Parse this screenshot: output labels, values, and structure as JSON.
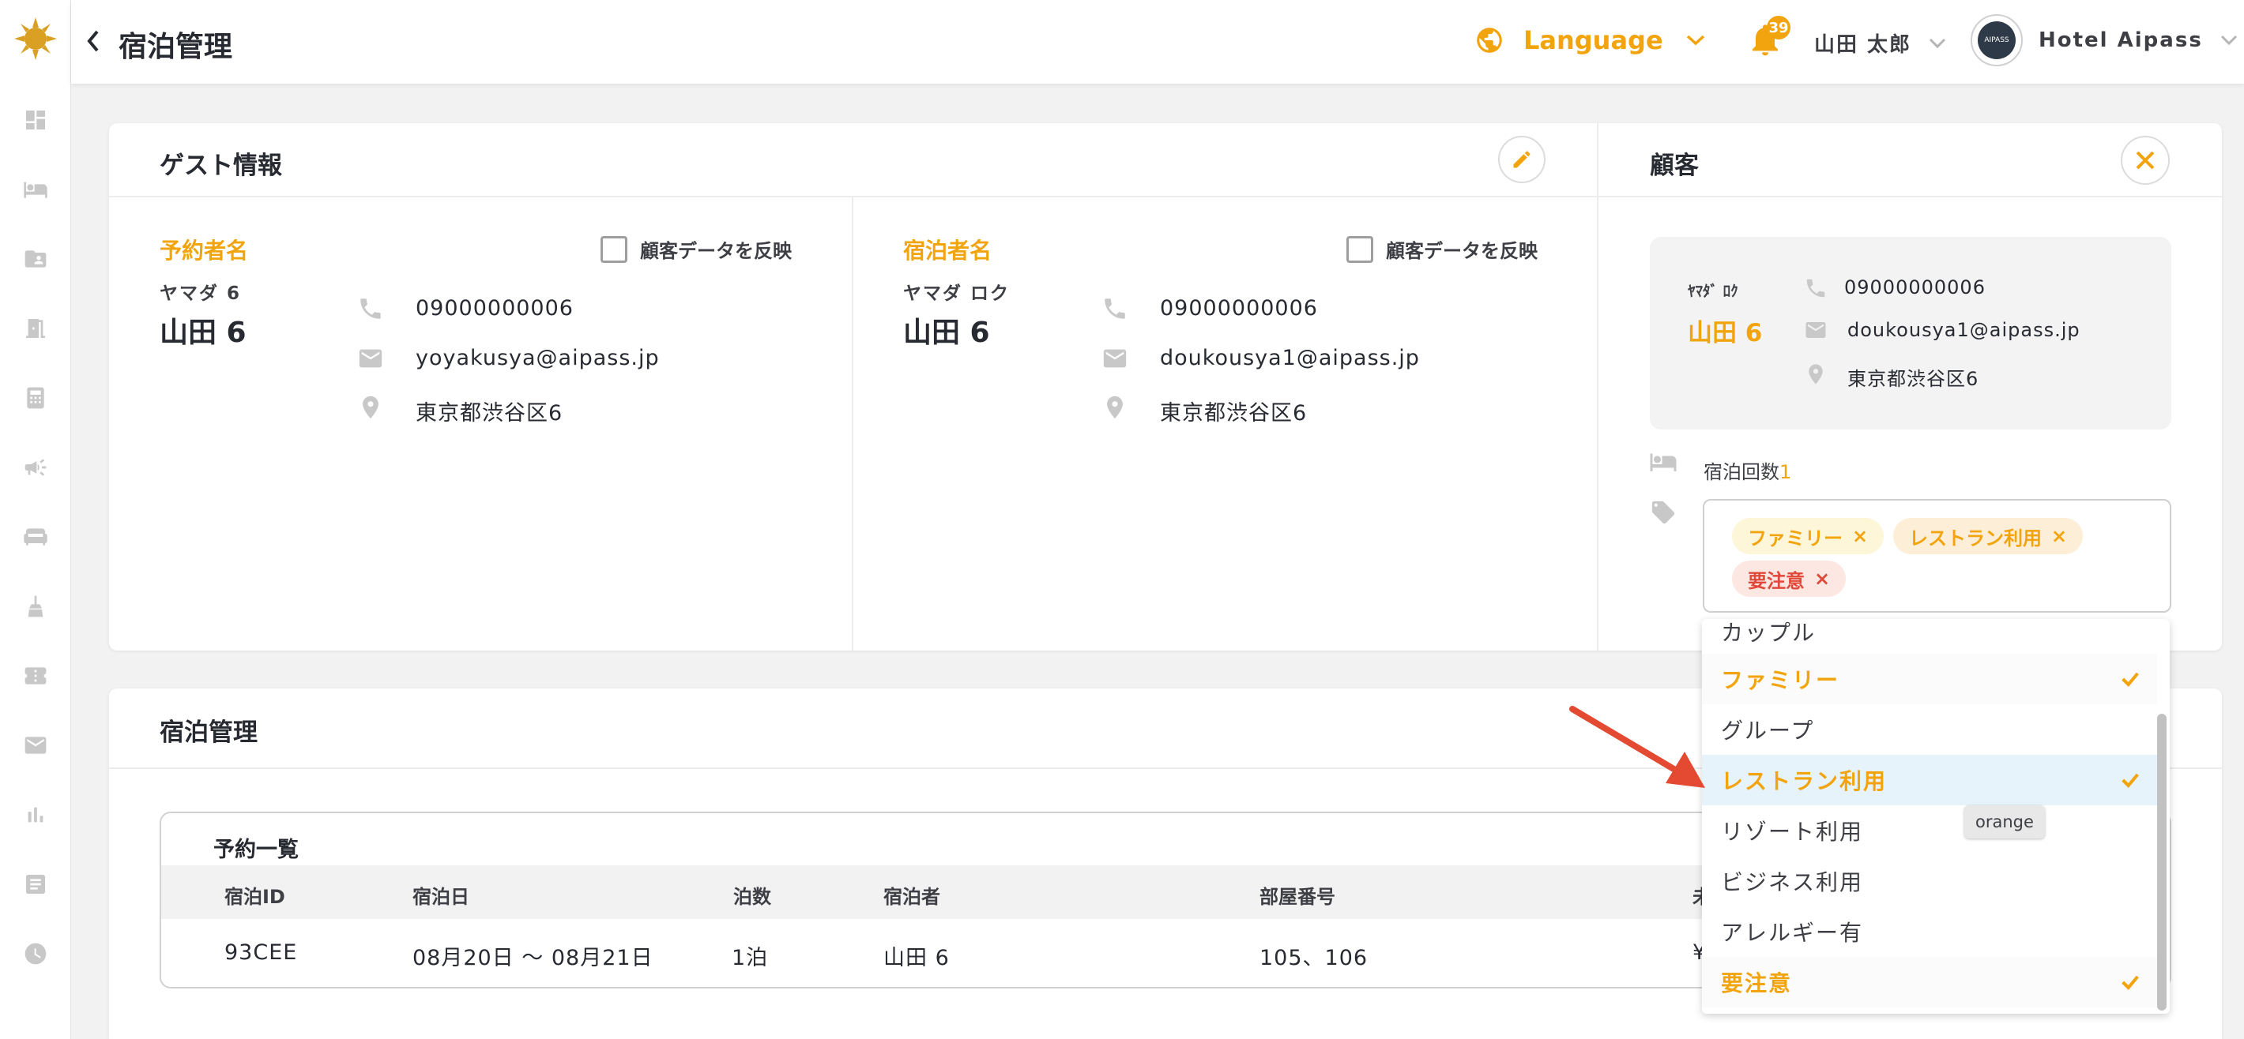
{
  "header": {
    "title": "宿泊管理",
    "language": "Language",
    "notification_count": "39",
    "user_name": "山田 太郎",
    "hotel_name": "Hotel Aipass",
    "avatar_text": "AIPASS"
  },
  "guest_card": {
    "title": "ゲスト情報",
    "booker": {
      "label": "予約者名",
      "reflect_label": "顧客データを反映",
      "kana": "ヤマダ 6",
      "name": "山田 6",
      "phone": "09000000006",
      "email": "yoyakusya@aipass.jp",
      "address": "東京都渋谷区6"
    },
    "guest": {
      "label": "宿泊者名",
      "reflect_label": "顧客データを反映",
      "kana": "ヤマダ ロク",
      "name": "山田 6",
      "phone": "09000000006",
      "email": "doukousya1@aipass.jp",
      "address": "東京都渋谷区6"
    }
  },
  "customer_card": {
    "title": "顧客",
    "kana": "ﾔﾏﾀﾞ ﾛｸ",
    "name": "山田 6",
    "phone": "09000000006",
    "email": "doukousya1@aipass.jp",
    "address": "東京都渋谷区6",
    "stay_count_label": "宿泊回数",
    "stay_count": "1",
    "tags": [
      {
        "label": "ファミリー",
        "remove": "×",
        "color": "#f2a40e",
        "bg": "#fef6d8"
      },
      {
        "label": "レストラン利用",
        "remove": "×",
        "color": "#f2a40e",
        "bg": "#fdeed7"
      },
      {
        "label": "要注意",
        "remove": "×",
        "color": "#e0493a",
        "bg": "#fce7e2"
      }
    ]
  },
  "tag_dropdown": {
    "options": [
      {
        "label": "カップル",
        "selected": false
      },
      {
        "label": "ファミリー",
        "selected": true
      },
      {
        "label": "グループ",
        "selected": false
      },
      {
        "label": "レストラン利用",
        "selected": true
      },
      {
        "label": "リゾート利用",
        "selected": false
      },
      {
        "label": "ビジネス利用",
        "selected": false
      },
      {
        "label": "アレルギー有",
        "selected": false
      },
      {
        "label": "要注意",
        "selected": true
      }
    ],
    "tooltip": "orange"
  },
  "stay_card": {
    "title": "宿泊管理",
    "list_title": "予約一覧",
    "columns": [
      "宿泊ID",
      "宿泊日",
      "泊数",
      "宿泊者",
      "部屋番号",
      "未"
    ],
    "rows": [
      {
        "id": "93CEE",
        "date": "08月20日 ～ 08月21日",
        "nights": "1泊",
        "guest": "山田 6",
        "room": "105、106",
        "extra": "¥"
      }
    ]
  },
  "colors": {
    "accent": "#f2a40e",
    "danger": "#e0493a",
    "highlight": "#e6f3fb",
    "arrow": "#e34a31"
  }
}
